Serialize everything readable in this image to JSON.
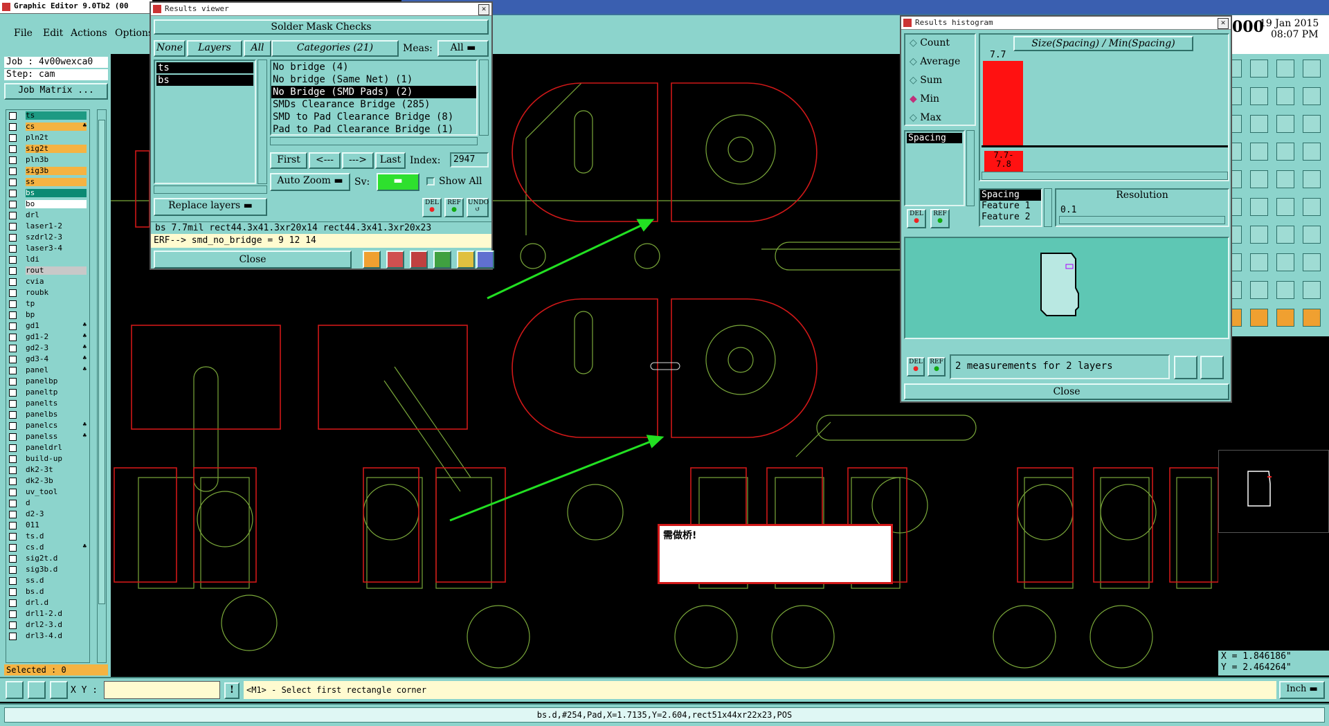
{
  "app": {
    "title": "Graphic Editor 9.0Tb2 (00",
    "menu": [
      "File",
      "Edit",
      "Actions",
      "Options"
    ],
    "date": "19 Jan 2015",
    "time": "08:07 PM",
    "clock_prefix": "000",
    "job_label": "Job : 4v00wexca0",
    "step_label": "Step: cam",
    "job_matrix_button": "Job Matrix ...",
    "selected_label": "Selected : 0"
  },
  "layers": [
    {
      "name": "ts",
      "color": "green"
    },
    {
      "name": "cs",
      "color": "orange",
      "mark": "♣"
    },
    {
      "name": "pln2t",
      "color": "teal"
    },
    {
      "name": "sig2t",
      "color": "orange"
    },
    {
      "name": "pln3b",
      "color": "teal"
    },
    {
      "name": "sig3b",
      "color": "orange"
    },
    {
      "name": "ss",
      "color": "orange"
    },
    {
      "name": "bs",
      "color": "hl"
    },
    {
      "name": "bo",
      "color": "white"
    },
    {
      "name": "drl",
      "color": "teal"
    },
    {
      "name": "laser1-2",
      "color": "teal"
    },
    {
      "name": "szdrl2-3",
      "color": "teal"
    },
    {
      "name": "laser3-4",
      "color": "teal"
    },
    {
      "name": "ldi",
      "color": "teal"
    },
    {
      "name": "rout",
      "color": "grey"
    },
    {
      "name": "cvia",
      "color": "teal"
    },
    {
      "name": "roubk",
      "color": "teal"
    },
    {
      "name": "tp",
      "color": "teal"
    },
    {
      "name": "bp",
      "color": "teal"
    },
    {
      "name": "gd1",
      "color": "teal",
      "mark": "♣"
    },
    {
      "name": "gd1-2",
      "color": "teal",
      "mark": "♣"
    },
    {
      "name": "gd2-3",
      "color": "teal",
      "mark": "♣"
    },
    {
      "name": "gd3-4",
      "color": "teal",
      "mark": "♣"
    },
    {
      "name": "panel",
      "color": "teal",
      "mark": "♣"
    },
    {
      "name": "panelbp",
      "color": "teal"
    },
    {
      "name": "paneltp",
      "color": "teal"
    },
    {
      "name": "panelts",
      "color": "teal"
    },
    {
      "name": "panelbs",
      "color": "teal"
    },
    {
      "name": "panelcs",
      "color": "teal",
      "mark": "♣"
    },
    {
      "name": "panelss",
      "color": "teal",
      "mark": "♣"
    },
    {
      "name": "paneldrl",
      "color": "teal"
    },
    {
      "name": "build-up",
      "color": "teal"
    },
    {
      "name": "dk2-3t",
      "color": "teal"
    },
    {
      "name": "dk2-3b",
      "color": "teal"
    },
    {
      "name": "uv_tool",
      "color": "teal"
    },
    {
      "name": "d",
      "color": "teal"
    },
    {
      "name": "d2-3",
      "color": "teal"
    },
    {
      "name": "011",
      "color": "teal"
    },
    {
      "name": "ts.d",
      "color": "teal"
    },
    {
      "name": "cs.d",
      "color": "teal",
      "mark": "♣"
    },
    {
      "name": "sig2t.d",
      "color": "teal"
    },
    {
      "name": "sig3b.d",
      "color": "teal"
    },
    {
      "name": "ss.d",
      "color": "teal"
    },
    {
      "name": "bs.d",
      "color": "teal"
    },
    {
      "name": "drl.d",
      "color": "teal"
    },
    {
      "name": "drl1-2.d",
      "color": "teal"
    },
    {
      "name": "drl2-3.d",
      "color": "teal"
    },
    {
      "name": "drl3-4.d",
      "color": "teal"
    }
  ],
  "results_viewer": {
    "window_title": "Results viewer",
    "header": "Solder Mask Checks",
    "none_label": "None",
    "layers_label": "Layers",
    "all_label": "All",
    "categories_label": "Categories (21)",
    "meas_label": "Meas:",
    "meas_value": "All",
    "layer_items": [
      "ts",
      "bs"
    ],
    "categories": [
      "No bridge (4)",
      "No bridge (Same Net) (1)",
      "No Bridge (SMD Pads) (2)",
      "SMDs Clearance Bridge (285)",
      "SMD to Pad Clearance Bridge (8)",
      "Pad to Pad Clearance Bridge (1)"
    ],
    "first_label": "First",
    "prev_label": "<---",
    "next_label": "--->",
    "last_label": "Last",
    "index_label": "Index:",
    "index_value": "2947",
    "auto_zoom_label": "Auto Zoom",
    "sv_label": "Sv:",
    "show_all_label": "Show All",
    "replace_layers_label": "Replace layers",
    "del_label": "DEL",
    "ref_label": "REF",
    "undo_label": "UNDO",
    "info_line": "bs 7.7mil   rect44.3x41.3xr20x14   rect44.3x41.3xr20x23",
    "erf_line": "ERF--> smd_no_bridge = 9 12 14",
    "close_label": "Close"
  },
  "histogram": {
    "window_title": "Results histogram",
    "options": [
      "Count",
      "Average",
      "Sum",
      "Min",
      "Max"
    ],
    "selected_option": "Min",
    "title": "Size(Spacing) / Min(Spacing)",
    "bar_value_label": "7.7",
    "bar_value": 7.7,
    "bin_label_1": "7.7-",
    "bin_label_2": "7.8",
    "measure_list": [
      "Spacing"
    ],
    "feature_list": [
      "Spacing",
      "Feature 1",
      "Feature 2"
    ],
    "resolution_label": "Resolution",
    "resolution_value": "0.1",
    "del_label": "DEL",
    "ref_label": "REF",
    "status": "2 measurements for 2 layers",
    "close_label": "Close"
  },
  "canvas": {
    "popup_text": "需做桥!",
    "coord_x": "X = 1.846186\"",
    "coord_y": "Y = 2.464264\""
  },
  "bottom": {
    "xy_label": "X Y :",
    "xy_value": "",
    "prompt": "<M1> - Select first rectangle corner",
    "units": "Inch",
    "status_line": "bs.d,#254,Pad,X=1.7135,Y=2.604,rect51x44xr22x23,POS"
  },
  "colors": {
    "panel": "#8cd4cc",
    "outline_red": "#d01818",
    "outline_green": "#7aa83a",
    "arrow": "#22e022",
    "histogram_bar": "#ff1111"
  }
}
